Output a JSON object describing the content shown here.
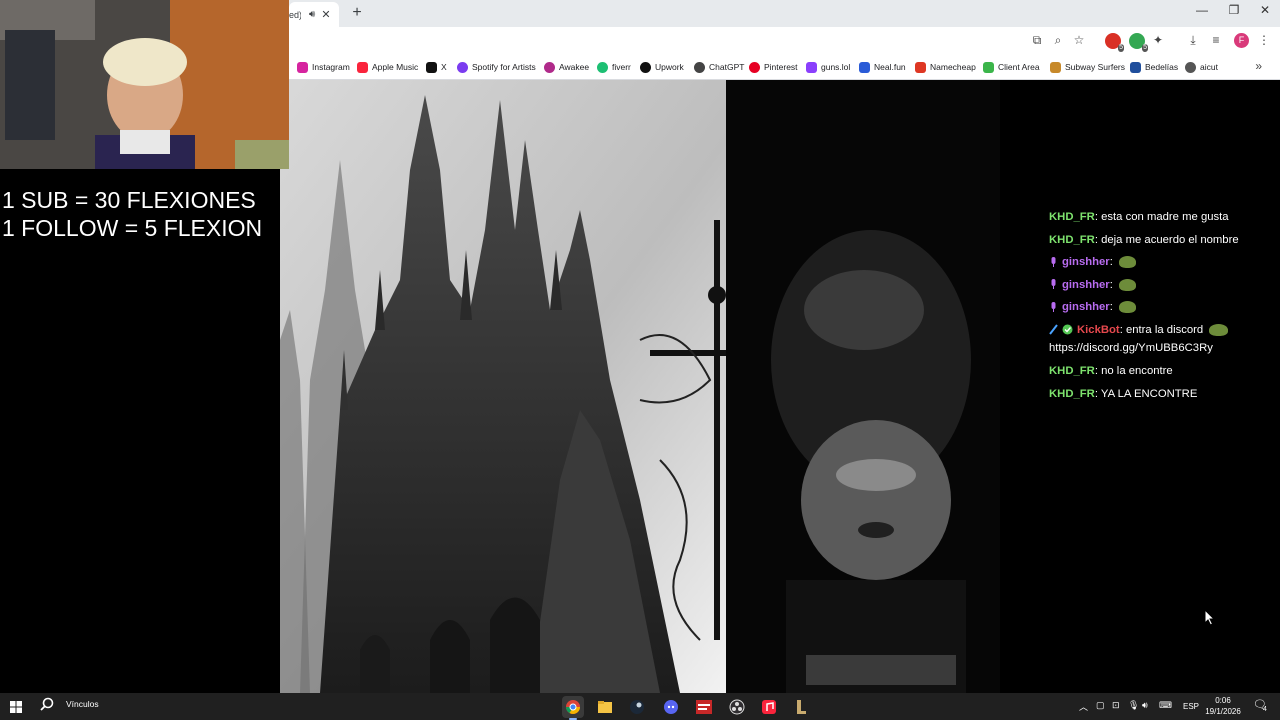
{
  "browser": {
    "tab_title": "ed)",
    "new_tab_label": "+",
    "window_controls": [
      "minimize",
      "restore",
      "close"
    ],
    "bookmarks": [
      {
        "label": "Instagram",
        "color": "#d6249f"
      },
      {
        "label": "Apple Music",
        "color": "#fa243c"
      },
      {
        "label": "X",
        "color": "#111111"
      },
      {
        "label": "Spotify for Artists",
        "color": "#7b3cf0"
      },
      {
        "label": "Awakee",
        "color": "#b02a8a"
      },
      {
        "label": "fiverr",
        "color": "#1dbf73"
      },
      {
        "label": "Upwork",
        "color": "#111111"
      },
      {
        "label": "ChatGPT",
        "color": "#444444"
      },
      {
        "label": "Pinterest",
        "color": "#e60023"
      },
      {
        "label": "guns.lol",
        "color": "#8a3ffc"
      },
      {
        "label": "Neal.fun",
        "color": "#2a5bd7"
      },
      {
        "label": "Namecheap",
        "color": "#de3723"
      },
      {
        "label": "Client Area",
        "color": "#3bb54a"
      },
      {
        "label": "Subway Surfers",
        "color": "#c7892a"
      },
      {
        "label": "Bedelías",
        "color": "#1f4e9c"
      },
      {
        "label": "aicut",
        "color": "#555555"
      }
    ],
    "profile_initial": "F",
    "extension_badges": [
      "5",
      "5"
    ]
  },
  "overlay": {
    "line1": "1 SUB = 30 FLEXIONES",
    "line2": "1 FOLLOW = 5 FLEXION"
  },
  "chat": {
    "messages": [
      {
        "user": "KHD_FR",
        "color": "#7ee36e",
        "text": ": esta con madre me gusta",
        "emote": false,
        "badge": ""
      },
      {
        "user": "KHD_FR",
        "color": "#7ee36e",
        "text": ": deja me acuerdo el nombre",
        "emote": false,
        "badge": ""
      },
      {
        "user": "ginshher",
        "color": "#b86cf0",
        "text": ":",
        "emote": true,
        "badge": "purple"
      },
      {
        "user": "ginshher",
        "color": "#b86cf0",
        "text": ":",
        "emote": true,
        "badge": "purple"
      },
      {
        "user": "ginshher",
        "color": "#b86cf0",
        "text": ":",
        "emote": true,
        "badge": "purple"
      },
      {
        "user": "KickBot",
        "color": "#e5484d",
        "text": ": entra la discord",
        "emote": true,
        "badge": "bot"
      },
      {
        "user": "KHD_FR",
        "color": "#7ee36e",
        "text": ": no la encontre",
        "emote": false,
        "badge": ""
      },
      {
        "user": "KHD_FR",
        "color": "#7ee36e",
        "text": ": YA LA ENCONTRE",
        "emote": false,
        "badge": ""
      }
    ],
    "kickbot_link": "https://discord.gg/YmUBB6C3Ry"
  },
  "taskbar": {
    "search_label": "Vínculos",
    "language": "ESP",
    "time": "0:06",
    "date": "19/1/2026",
    "notification_count": "4"
  }
}
